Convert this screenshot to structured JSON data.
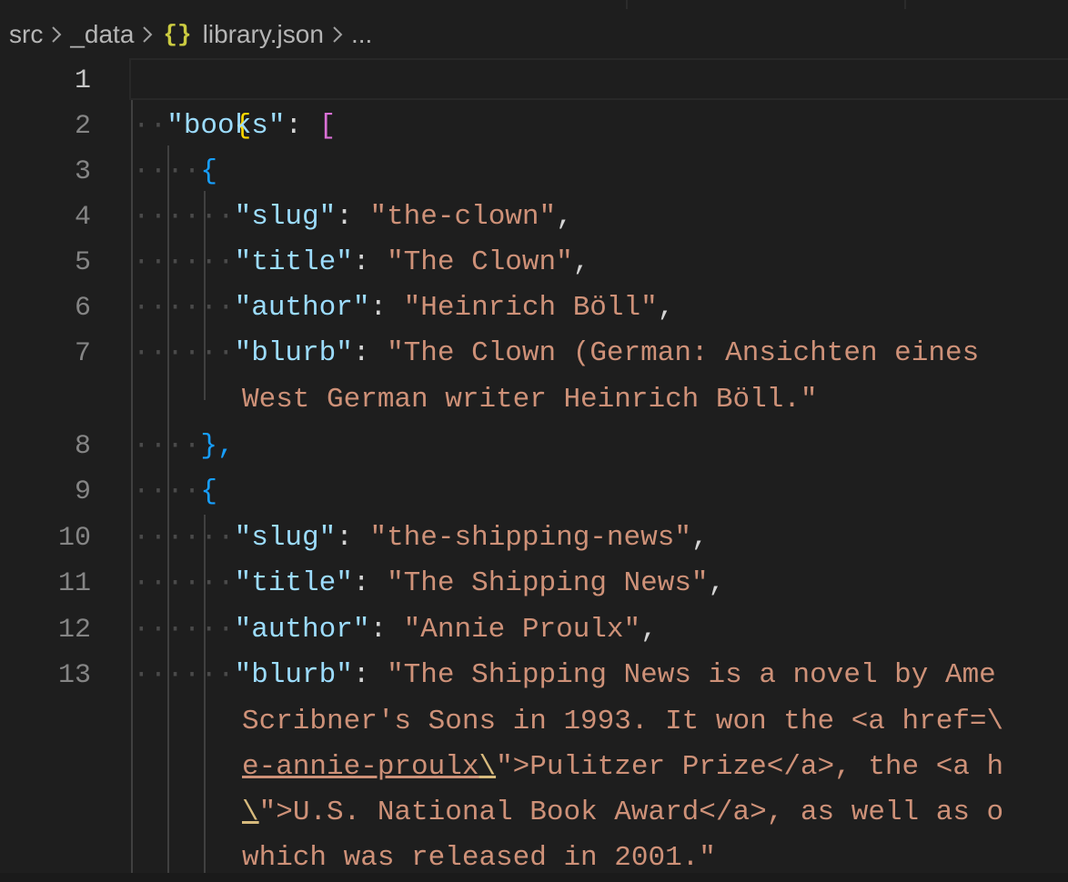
{
  "breadcrumbs": {
    "items": [
      "src",
      "_data",
      "library.json",
      "..."
    ],
    "separator": ">",
    "file_icon": "{}"
  },
  "line_numbers": [
    "1",
    "2",
    "3",
    "4",
    "5",
    "6",
    "7",
    "8",
    "9",
    "10",
    "11",
    "12",
    "13"
  ],
  "active_line": "1",
  "code": {
    "open_root": "{",
    "books_key": "\"books\"",
    "colon": ": ",
    "open_array": "[",
    "open_obj": "{",
    "close_obj_comma": "},",
    "book1": {
      "slug_key": "\"slug\"",
      "slug_val": "\"the-clown\"",
      "title_key": "\"title\"",
      "title_val": "\"The Clown\"",
      "author_key": "\"author\"",
      "author_val": "\"Heinrich Böll\"",
      "blurb_key": "\"blurb\"",
      "blurb_line1": "\"The Clown (German: Ansichten eines ",
      "blurb_line2": "West German writer Heinrich Böll.\""
    },
    "book2": {
      "slug_key": "\"slug\"",
      "slug_val": "\"the-shipping-news\"",
      "title_key": "\"title\"",
      "title_val": "\"The Shipping News\"",
      "author_key": "\"author\"",
      "author_val": "\"Annie Proulx\"",
      "blurb_key": "\"blurb\"",
      "blurb_line1": "\"The Shipping News is a novel by Ame",
      "blurb_line2": "Scribner's Sons in 1993. It won the <a href=\\",
      "blurb_line3a": "e-annie-proulx",
      "blurb_line3b": "\\",
      "blurb_line3c": "\">Pulitzer Prize</a>, the <a h",
      "blurb_line4a": "\\",
      "blurb_line4b": "\">U.S. National Book Award</a>, as well as o",
      "blurb_line5": "which was released in 2001.\""
    }
  },
  "colors": {
    "background": "#1e1e1e",
    "key": "#9cdcfe",
    "string": "#ce9178",
    "bracket_level1": "#ffd700",
    "bracket_level2": "#da70d6",
    "bracket_level3": "#179fff",
    "json_icon": "#cbcb41"
  }
}
